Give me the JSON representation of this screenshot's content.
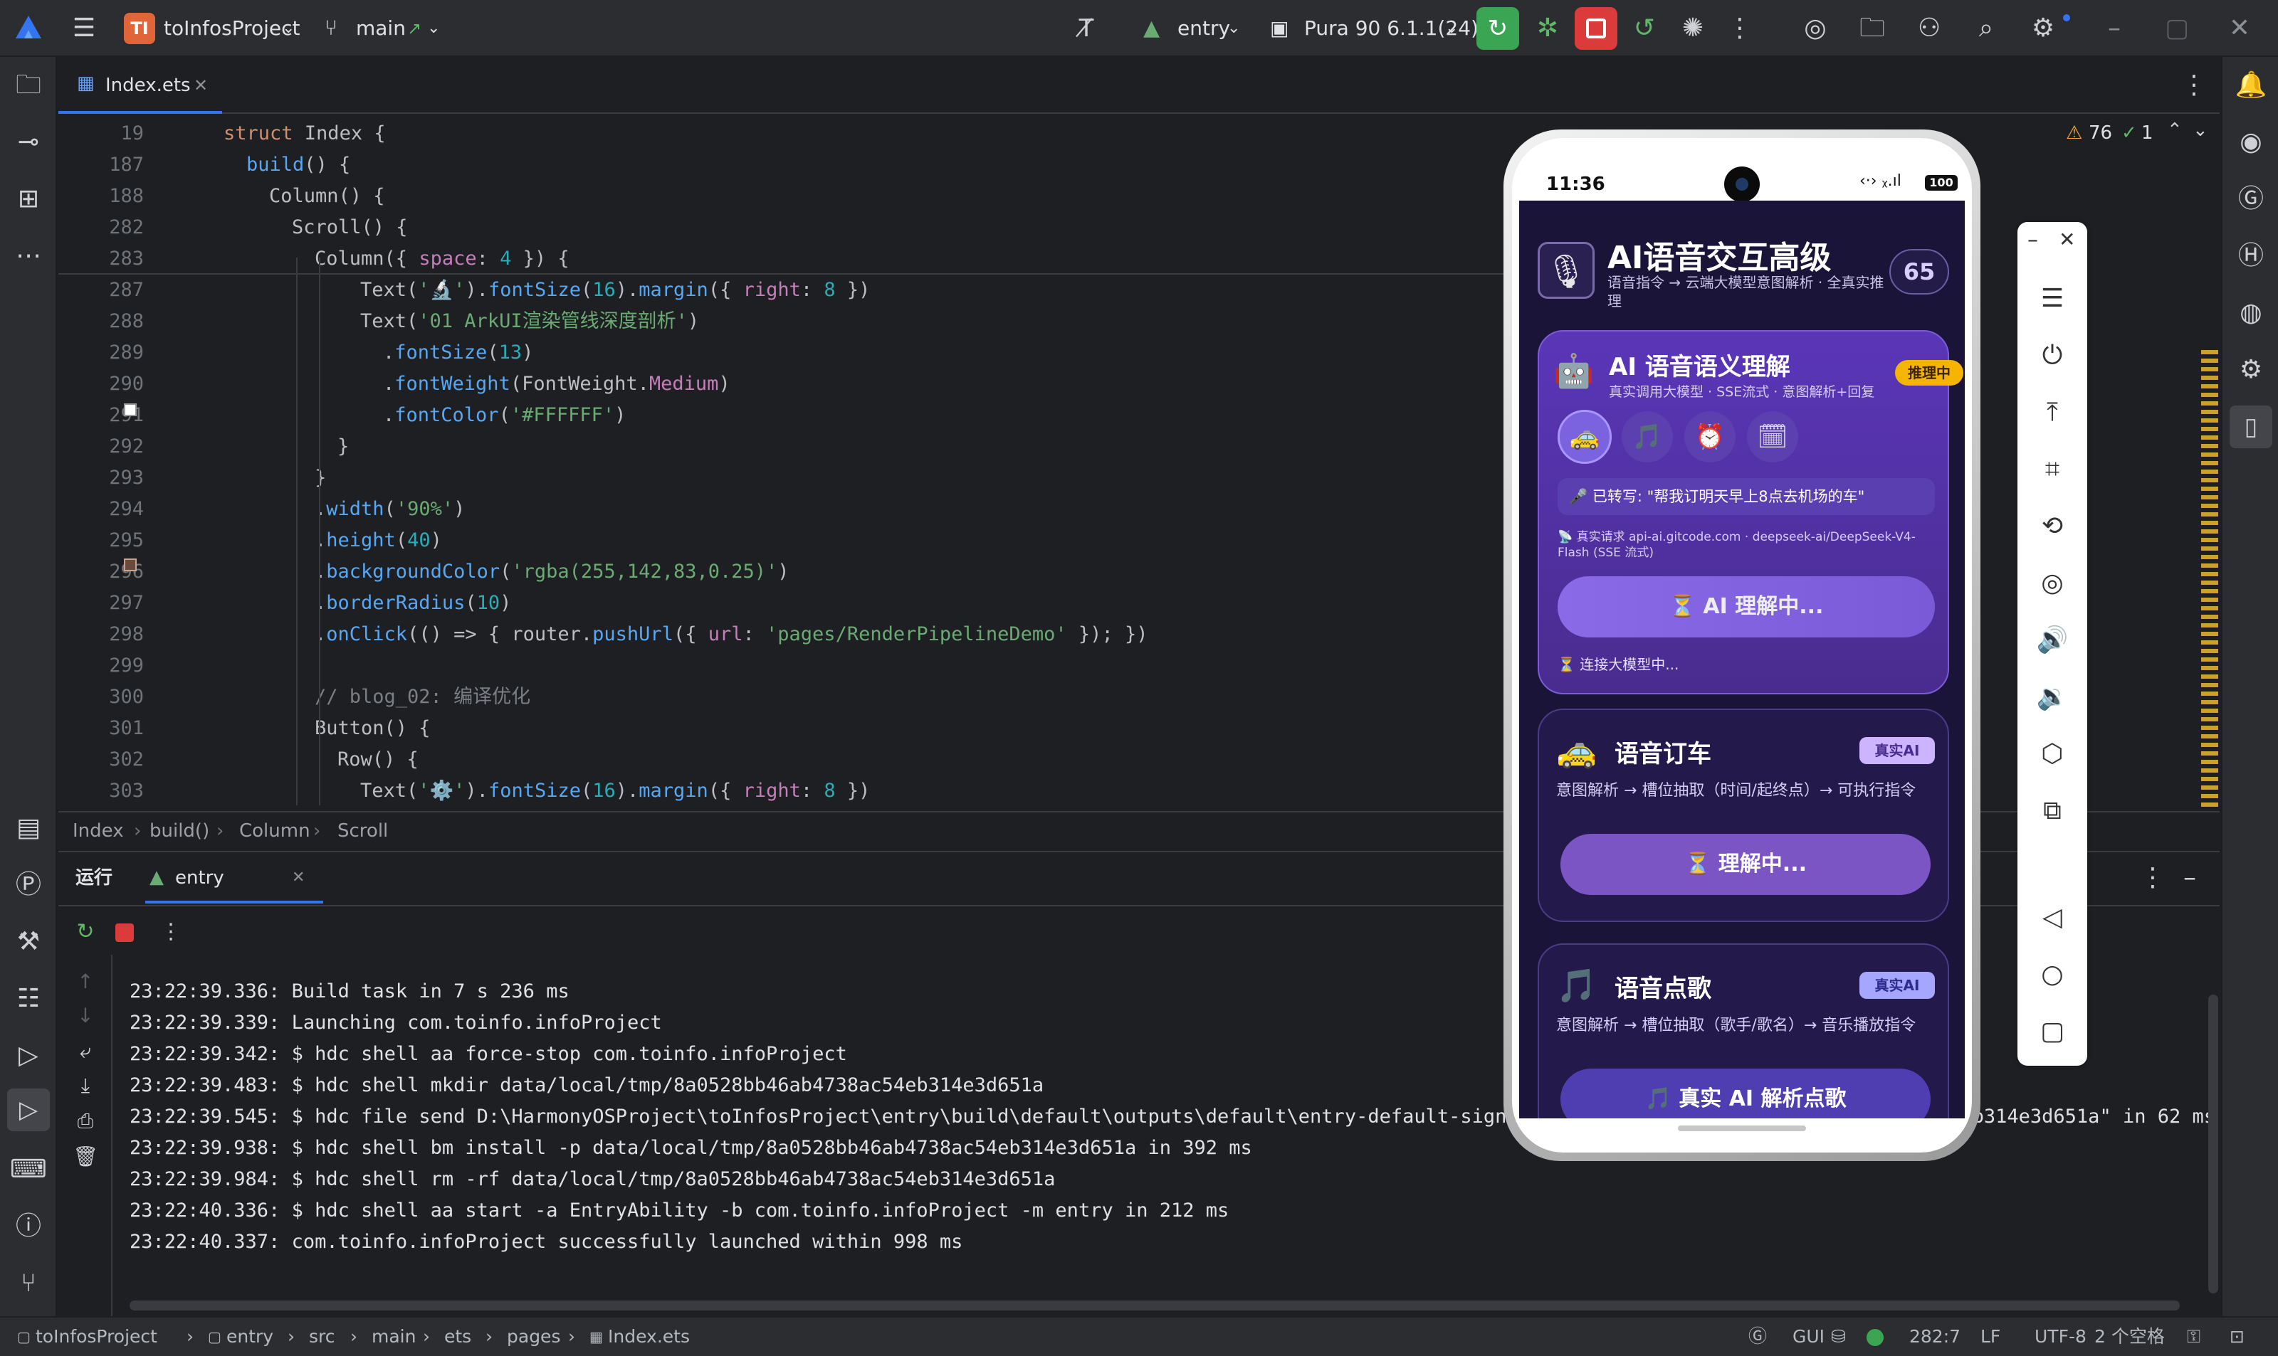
{
  "titlebar": {
    "project_badge": "TI",
    "project_name": "toInfosProject",
    "branch": "main",
    "run_config": "entry",
    "device": "Pura 90 6.1.1(24)"
  },
  "editor": {
    "tab": "Index.ets",
    "warnings": "76",
    "checks": "1",
    "lines": [
      {
        "n": "19",
        "indent": 2,
        "parts": [
          [
            "kw",
            "struct "
          ],
          [
            "ty",
            "Index "
          ],
          [
            "ty",
            "{"
          ]
        ]
      },
      {
        "n": "187",
        "indent": 4,
        "parts": [
          [
            "fn",
            "build"
          ],
          [
            "ty",
            "() {"
          ]
        ]
      },
      {
        "n": "188",
        "indent": 6,
        "parts": [
          [
            "ty",
            "Column() {"
          ]
        ]
      },
      {
        "n": "282",
        "indent": 8,
        "parts": [
          [
            "ty",
            "Scroll() {"
          ]
        ]
      },
      {
        "n": "283",
        "indent": 10,
        "parts": [
          [
            "ty",
            "Column({ "
          ],
          [
            "fld",
            "space"
          ],
          [
            "ty",
            ": "
          ],
          [
            "num",
            "4"
          ],
          [
            "ty",
            " }) {"
          ]
        ]
      },
      {
        "n": "287",
        "indent": 14,
        "parts": [
          [
            "ty",
            "Text("
          ],
          [
            "str",
            "'🔬'"
          ],
          [
            "ty",
            ")."
          ],
          [
            "fn",
            "fontSize"
          ],
          [
            "ty",
            "("
          ],
          [
            "num",
            "16"
          ],
          [
            "ty",
            ")."
          ],
          [
            "fn",
            "margin"
          ],
          [
            "ty",
            "({ "
          ],
          [
            "fld",
            "right"
          ],
          [
            "ty",
            ": "
          ],
          [
            "num",
            "8"
          ],
          [
            "ty",
            " })"
          ]
        ]
      },
      {
        "n": "288",
        "indent": 14,
        "parts": [
          [
            "ty",
            "Text("
          ],
          [
            "str",
            "'01 ArkUI渲染管线深度剖析'"
          ],
          [
            "ty",
            ")"
          ]
        ]
      },
      {
        "n": "289",
        "indent": 16,
        "parts": [
          [
            "ty",
            "."
          ],
          [
            "fn",
            "fontSize"
          ],
          [
            "ty",
            "("
          ],
          [
            "num",
            "13"
          ],
          [
            "ty",
            ")"
          ]
        ]
      },
      {
        "n": "290",
        "indent": 16,
        "parts": [
          [
            "ty",
            "."
          ],
          [
            "fn",
            "fontWeight"
          ],
          [
            "ty",
            "(FontWeight."
          ],
          [
            "fld",
            "Medium"
          ],
          [
            "ty",
            ")"
          ]
        ]
      },
      {
        "n": "291",
        "indent": 16,
        "parts": [
          [
            "ty",
            "."
          ],
          [
            "fn",
            "fontColor"
          ],
          [
            "ty",
            "("
          ],
          [
            "str",
            "'#FFFFFF'"
          ],
          [
            "ty",
            ")"
          ]
        ]
      },
      {
        "n": "292",
        "indent": 12,
        "parts": [
          [
            "ty",
            "}"
          ]
        ]
      },
      {
        "n": "293",
        "indent": 10,
        "parts": [
          [
            "ty",
            "}"
          ]
        ]
      },
      {
        "n": "294",
        "indent": 10,
        "parts": [
          [
            "ty",
            "."
          ],
          [
            "fn",
            "width"
          ],
          [
            "ty",
            "("
          ],
          [
            "str",
            "'90%'"
          ],
          [
            "ty",
            ")"
          ]
        ]
      },
      {
        "n": "295",
        "indent": 10,
        "parts": [
          [
            "ty",
            "."
          ],
          [
            "fn",
            "height"
          ],
          [
            "ty",
            "("
          ],
          [
            "num",
            "40"
          ],
          [
            "ty",
            ")"
          ]
        ]
      },
      {
        "n": "296",
        "indent": 10,
        "parts": [
          [
            "ty",
            "."
          ],
          [
            "fn",
            "backgroundColor"
          ],
          [
            "ty",
            "("
          ],
          [
            "str",
            "'rgba(255,142,83,0.25)'"
          ],
          [
            "ty",
            ")"
          ]
        ]
      },
      {
        "n": "297",
        "indent": 10,
        "parts": [
          [
            "ty",
            "."
          ],
          [
            "fn",
            "borderRadius"
          ],
          [
            "ty",
            "("
          ],
          [
            "num",
            "10"
          ],
          [
            "ty",
            ")"
          ]
        ]
      },
      {
        "n": "298",
        "indent": 10,
        "parts": [
          [
            "ty",
            "."
          ],
          [
            "fn",
            "onClick"
          ],
          [
            "ty",
            "(() => { router."
          ],
          [
            "fn",
            "pushUrl"
          ],
          [
            "ty",
            "({ "
          ],
          [
            "fld",
            "url"
          ],
          [
            "ty",
            ": "
          ],
          [
            "str",
            "'pages/RenderPipelineDemo'"
          ],
          [
            "ty",
            " }); })"
          ]
        ]
      },
      {
        "n": "299",
        "indent": 0,
        "parts": [
          [
            "ty",
            ""
          ]
        ]
      },
      {
        "n": "300",
        "indent": 10,
        "parts": [
          [
            "cm",
            "// blog_02: 编译优化"
          ]
        ]
      },
      {
        "n": "301",
        "indent": 10,
        "parts": [
          [
            "ty",
            "Button() {"
          ]
        ]
      },
      {
        "n": "302",
        "indent": 12,
        "parts": [
          [
            "ty",
            "Row() {"
          ]
        ]
      },
      {
        "n": "303",
        "indent": 14,
        "parts": [
          [
            "ty",
            "Text("
          ],
          [
            "str",
            "'⚙️'"
          ],
          [
            "ty",
            ")."
          ],
          [
            "fn",
            "fontSize"
          ],
          [
            "ty",
            "("
          ],
          [
            "num",
            "16"
          ],
          [
            "ty",
            ")."
          ],
          [
            "fn",
            "margin"
          ],
          [
            "ty",
            "({ "
          ],
          [
            "fld",
            "right"
          ],
          [
            "ty",
            ": "
          ],
          [
            "num",
            "8"
          ],
          [
            "ty",
            " })"
          ]
        ]
      }
    ]
  },
  "breadcrumb": [
    "Index",
    "build()",
    "Column",
    "Scroll"
  ],
  "runpanel": {
    "tab_run": "运行",
    "tab_entry": "entry",
    "log": [
      "23:22:39.336: Build task in 7 s 236 ms",
      "23:22:39.339: Launching com.toinfo.infoProject",
      "23:22:39.342: $ hdc shell aa force-stop com.toinfo.infoProject",
      "23:22:39.483: $ hdc shell mkdir data/local/tmp/8a0528bb46ab4738ac54eb314e3d651a",
      "23:22:39.545: $ hdc file send D:\\HarmonyOSProject\\toInfosProject\\entry\\build\\default\\outputs\\default\\entry-default-signed",
      "23:22:39.938: $ hdc shell bm install -p data/local/tmp/8a0528bb46ab4738ac54eb314e3d651a in 392 ms",
      "23:22:39.984: $ hdc shell rm -rf data/local/tmp/8a0528bb46ab4738ac54eb314e3d651a",
      "23:22:40.336: $ hdc shell aa start -a EntryAbility -b com.toinfo.infoProject -m entry in 212 ms",
      "23:22:40.337: com.toinfo.infoProject successfully launched within 998 ms"
    ],
    "log_tail": "eb314e3d651a\" in 62 ms"
  },
  "statusbar": {
    "path": [
      "toInfosProject",
      "entry",
      "src",
      "main",
      "ets",
      "pages",
      "Index.ets"
    ],
    "gui": "GUI",
    "position": "282:7",
    "line_sep": "LF",
    "encoding": "UTF-8",
    "indent": "2 个空格"
  },
  "phone": {
    "time": "11:36",
    "battery": "100",
    "header_title": "AI语音交互高级",
    "header_sub": "语音指令 → 云端大模型意图解析 · 全真实推理",
    "header_badge": "65",
    "card1": {
      "title": "AI 语音语义理解",
      "badge": "推理中",
      "sub": "真实调用大模型 · SSE流式 · 意图解析+回复",
      "transcript": "🎤 已转写: \"帮我订明天早上8点去机场的车\"",
      "request": "📡 真实请求 api-ai.gitcode.com · deepseek-ai/DeepSeek-V4-Flash (SSE 流式)",
      "button": "⏳ AI 理解中...",
      "status": "⏳ 连接大模型中..."
    },
    "card2": {
      "title": "语音订车",
      "badge": "真实AI",
      "sub": "意图解析 → 槽位抽取（时间/起终点）→ 可执行指令",
      "button": "⏳ 理解中..."
    },
    "card3": {
      "title": "语音点歌",
      "badge": "真实AI",
      "sub": "意图解析 → 槽位抽取（歌手/歌名）→ 音乐播放指令",
      "button": "🎵 真实 AI 解析点歌"
    }
  },
  "colors": {
    "accent_green": "#3aa552",
    "accent_red": "#db3b3b",
    "ide_bg": "#1e1f22",
    "phone_bg": "#1a1438",
    "card_purple": "#4a2c8f",
    "badge_yellow": "#f5b400"
  }
}
